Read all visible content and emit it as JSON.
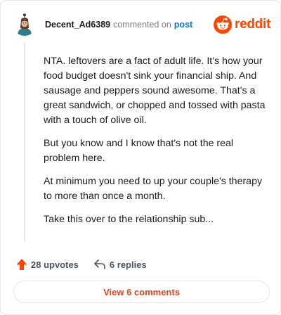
{
  "comment": {
    "username": "Decent_Ad6389",
    "action_text": "commented on",
    "post_link": "post",
    "paragraphs": [
      "NTA. leftovers are a fact of adult life. It's how your food budget doesn't sink your financial ship. And sausage and peppers sound awesome. That's a great sandwich, or chopped and tossed with pasta with a touch of olive oil.",
      "But you know and I know that's not the real problem here.",
      "At minimum you need to up your couple's therapy to more than once a month.",
      "Take this over to the relationship sub..."
    ]
  },
  "brand": {
    "wordmark": "reddit",
    "icon": "reddit-logo-icon",
    "color": "#ff4500"
  },
  "actions": {
    "upvotes_label": "28 upvotes",
    "upvote_icon": "upvote-arrow-icon",
    "replies_label": "6 replies",
    "reply_icon": "reply-arrow-icon"
  },
  "footer": {
    "view_comments_label": "View 6 comments"
  },
  "colors": {
    "accent": "#ff4500",
    "link": "#0079d3",
    "button_text": "#e0451f"
  }
}
